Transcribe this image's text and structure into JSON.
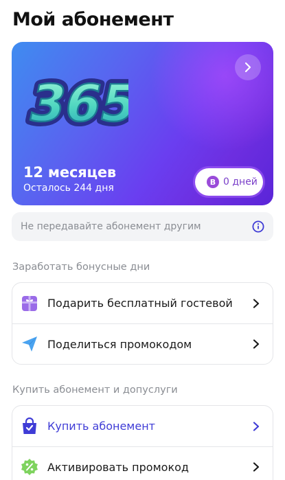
{
  "page": {
    "title": "Мой абонемент"
  },
  "subscription": {
    "logo_text": "365",
    "plan_title": "12 месяцев",
    "remaining": "Осталось 244 дня",
    "bonus_badge_letter": "В",
    "bonus_days": "0 дней"
  },
  "notice": {
    "text": "Не передавайте абонемент другим"
  },
  "bonus_section": {
    "title": "Заработать бонусные дни",
    "items": [
      {
        "label": "Подарить бесплатный гостевой",
        "icon": "gift-icon"
      },
      {
        "label": "Поделиться промокодом",
        "icon": "paper-plane-icon"
      }
    ]
  },
  "buy_section": {
    "title": "Купить абонемент и допуслуги",
    "items": [
      {
        "label": "Купить абонемент",
        "icon": "shopping-bag-icon"
      },
      {
        "label": "Активировать промокод",
        "icon": "discount-badge-icon"
      }
    ]
  },
  "colors": {
    "accent_blue": "#3f3cd6",
    "bonus_purple": "#9a4bd9"
  }
}
